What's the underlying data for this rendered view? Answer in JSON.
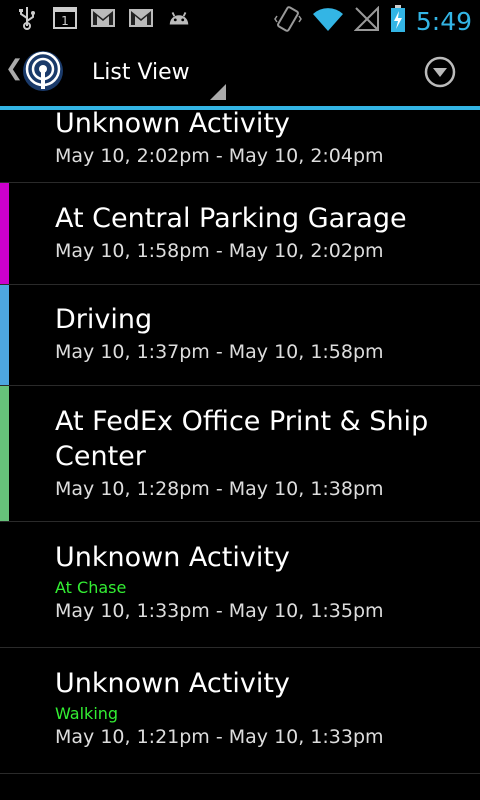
{
  "status_bar": {
    "time": "5:49",
    "notification_icons": [
      "usb-icon",
      "calendar-icon",
      "gmail-icon",
      "gmail-icon",
      "android-icon"
    ],
    "calendar_day": "1",
    "system_icons": [
      "vibrate-icon",
      "wifi-icon",
      "signal-icon",
      "battery-charging-icon"
    ],
    "clock_color": "#33b5e5"
  },
  "action_bar": {
    "title": "List View",
    "accent_color": "#33b5e5"
  },
  "list": {
    "items": [
      {
        "title": "Unknown Activity",
        "subtitle": "",
        "time": "May 10, 2:02pm - May 10, 2:04pm",
        "color": ""
      },
      {
        "title": "At Central Parking Garage",
        "subtitle": "",
        "time": "May 10, 1:58pm - May 10, 2:02pm",
        "color": "#cc00cc"
      },
      {
        "title": "Driving",
        "subtitle": "",
        "time": "May 10, 1:37pm - May 10, 1:58pm",
        "color": "#4da6e0"
      },
      {
        "title": "At FedEx Office Print & Ship Center",
        "subtitle": "",
        "time": "May 10, 1:28pm - May 10, 1:38pm",
        "color": "#66c27a"
      },
      {
        "title": "Unknown Activity",
        "subtitle": "At Chase",
        "time": "May 10, 1:33pm - May 10, 1:35pm",
        "color": ""
      },
      {
        "title": "Unknown Activity",
        "subtitle": "Walking",
        "time": "May 10, 1:21pm - May 10, 1:33pm",
        "color": ""
      }
    ]
  }
}
